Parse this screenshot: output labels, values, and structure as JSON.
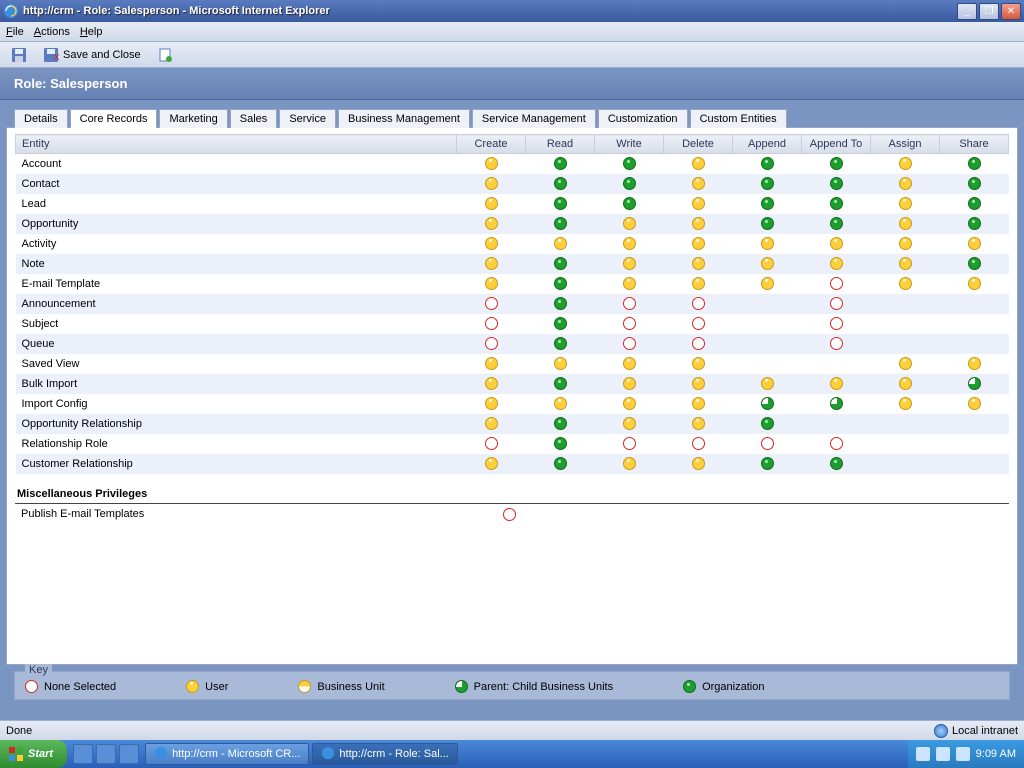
{
  "window": {
    "title": "http://crm - Role: Salesperson - Microsoft Internet Explorer"
  },
  "menu": {
    "file": "File",
    "actions": "Actions",
    "help": "Help"
  },
  "toolbar": {
    "save_close": "Save and Close"
  },
  "page": {
    "heading": "Role: Salesperson"
  },
  "tabs": [
    "Details",
    "Core Records",
    "Marketing",
    "Sales",
    "Service",
    "Business Management",
    "Service Management",
    "Customization",
    "Custom Entities"
  ],
  "active_tab": 1,
  "columns": [
    "Entity",
    "Create",
    "Read",
    "Write",
    "Delete",
    "Append",
    "Append To",
    "Assign",
    "Share"
  ],
  "rows": [
    {
      "e": "Account",
      "p": [
        "user",
        "org",
        "org",
        "user",
        "org",
        "org",
        "user",
        "org"
      ]
    },
    {
      "e": "Contact",
      "p": [
        "user",
        "org",
        "org",
        "user",
        "org",
        "org",
        "user",
        "org"
      ]
    },
    {
      "e": "Lead",
      "p": [
        "user",
        "org",
        "org",
        "user",
        "org",
        "org",
        "user",
        "org"
      ]
    },
    {
      "e": "Opportunity",
      "p": [
        "user",
        "org",
        "user",
        "user",
        "org",
        "org",
        "user",
        "org"
      ]
    },
    {
      "e": "Activity",
      "p": [
        "user",
        "user",
        "user",
        "user",
        "user",
        "user",
        "user",
        "user"
      ]
    },
    {
      "e": "Note",
      "p": [
        "user",
        "org",
        "user",
        "user",
        "user",
        "user",
        "user",
        "org"
      ]
    },
    {
      "e": "E-mail Template",
      "p": [
        "user",
        "org",
        "user",
        "user",
        "user",
        "none",
        "user",
        "user"
      ]
    },
    {
      "e": "Announcement",
      "p": [
        "none",
        "org",
        "none",
        "none",
        "",
        "none",
        "",
        ""
      ]
    },
    {
      "e": "Subject",
      "p": [
        "none",
        "org",
        "none",
        "none",
        "",
        "none",
        "",
        ""
      ]
    },
    {
      "e": "Queue",
      "p": [
        "none",
        "org",
        "none",
        "none",
        "",
        "none",
        "",
        ""
      ]
    },
    {
      "e": "Saved View",
      "p": [
        "user",
        "user",
        "user",
        "user",
        "",
        "",
        "user",
        "user"
      ]
    },
    {
      "e": "Bulk Import",
      "p": [
        "user",
        "org",
        "user",
        "user",
        "user",
        "user",
        "user",
        "pcbu"
      ]
    },
    {
      "e": "Import Config",
      "p": [
        "user",
        "user",
        "user",
        "user",
        "pcbu",
        "pcbu",
        "user",
        "user"
      ]
    },
    {
      "e": "Opportunity Relationship",
      "p": [
        "user",
        "org",
        "user",
        "user",
        "org",
        "",
        "",
        ""
      ]
    },
    {
      "e": "Relationship Role",
      "p": [
        "none",
        "org",
        "none",
        "none",
        "none",
        "none",
        "",
        ""
      ]
    },
    {
      "e": "Customer Relationship",
      "p": [
        "user",
        "org",
        "user",
        "user",
        "org",
        "org",
        "",
        ""
      ]
    }
  ],
  "misc": {
    "heading": "Miscellaneous Privileges",
    "rows": [
      {
        "label": "Publish E-mail Templates",
        "p": "none"
      }
    ]
  },
  "key": {
    "title": "Key",
    "items": [
      {
        "icon": "none",
        "label": "None Selected"
      },
      {
        "icon": "user",
        "label": "User"
      },
      {
        "icon": "bu",
        "label": "Business Unit"
      },
      {
        "icon": "pcbu",
        "label": "Parent: Child Business Units"
      },
      {
        "icon": "org",
        "label": "Organization"
      }
    ]
  },
  "status": {
    "text": "Done",
    "zone": "Local intranet"
  },
  "taskbar": {
    "start": "Start",
    "buttons": [
      {
        "label": "http://crm - Microsoft CR...",
        "active": false
      },
      {
        "label": "http://crm - Role: Sal...",
        "active": true
      }
    ],
    "time": "9:09 AM"
  }
}
